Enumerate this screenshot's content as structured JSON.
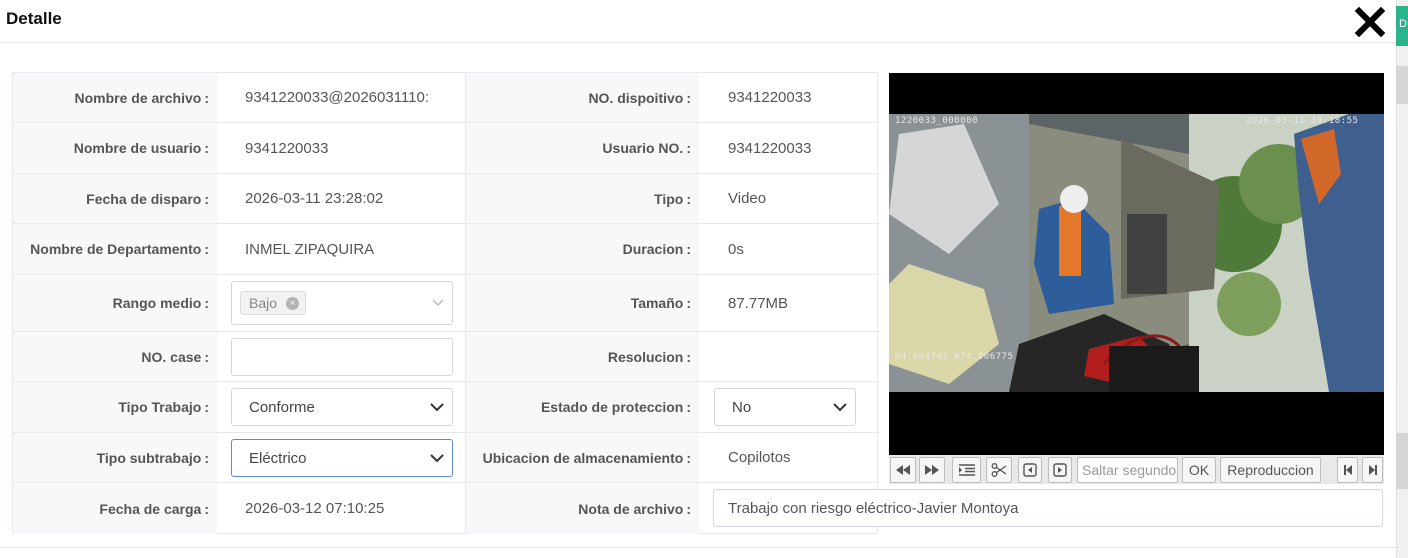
{
  "dialog": {
    "title": "Detalle"
  },
  "fields": {
    "nombre_archivo": {
      "label": "Nombre de archivo",
      "value": "9341220033@2026031110:"
    },
    "no_dispositivo": {
      "label": "NO. dispoitivo",
      "value": "9341220033"
    },
    "nombre_usuario": {
      "label": "Nombre de usuario",
      "value": "9341220033"
    },
    "usuario_no": {
      "label": "Usuario NO.",
      "value": "9341220033"
    },
    "fecha_disparo": {
      "label": "Fecha de disparo",
      "value": "2026-03-11 23:28:02"
    },
    "tipo": {
      "label": "Tipo",
      "value": "Video"
    },
    "departamento": {
      "label": "Nombre de Departamento",
      "value": "INMEL ZIPAQUIRA"
    },
    "duracion": {
      "label": "Duracion",
      "value": "0s"
    },
    "rango_medio": {
      "label": "Rango medio",
      "tag": "Bajo"
    },
    "tamano": {
      "label": "Tamaño",
      "value": "87.77MB"
    },
    "no_case": {
      "label": "NO. case",
      "value": ""
    },
    "resolucion": {
      "label": "Resolucion",
      "value": ""
    },
    "tipo_trabajo": {
      "label": "Tipo Trabajo",
      "value": "Conforme"
    },
    "estado_proteccion": {
      "label": "Estado de proteccion",
      "value": "No"
    },
    "tipo_subtrabajo": {
      "label": "Tipo subtrabajo",
      "value": "Eléctrico"
    },
    "ubicacion": {
      "label": "Ubicacion de almacenamiento",
      "value": "Copilotos"
    },
    "fecha_carga": {
      "label": "Fecha de carga",
      "value": "2026-03-12 07:10:25"
    },
    "nota_archivo": {
      "label": "Nota de archivo",
      "value": "Trabajo con riesgo eléctrico-Javier Montoya"
    }
  },
  "label_suffix": ":",
  "video": {
    "osd_left": "1220033_000000",
    "osd_right": "2026-03-11 10:18:55",
    "osd_gps": "N4.694743 W74.006775"
  },
  "controls": {
    "seek_placeholder": "Saltar segundos",
    "ok_label": "OK",
    "playback_label": "Reproduccion",
    "edge_tab": "D"
  },
  "colors": {
    "accent_tab": "#2bb38c",
    "focus_border": "#5b8dd6"
  }
}
